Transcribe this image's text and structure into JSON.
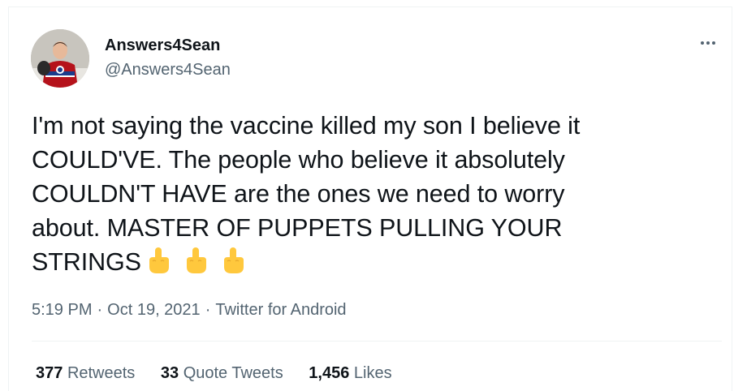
{
  "author": {
    "display_name": "Answers4Sean",
    "handle": "@Answers4Sean"
  },
  "tweet": {
    "lines": [
      "I'm not saying the vaccine killed my son I believe it",
      "COULD'VE. The people who believe it absolutely",
      "COULDN'T HAVE are the ones we need to worry",
      "about. MASTER OF PUPPETS PULLING YOUR",
      "STRINGS"
    ],
    "emojis": [
      "middle-finger",
      "middle-finger",
      "middle-finger"
    ]
  },
  "meta": {
    "time": "5:19 PM",
    "separator": "·",
    "date": "Oct 19, 2021",
    "source": "Twitter for Android"
  },
  "stats": {
    "retweets_count": "377",
    "retweets_label": "Retweets",
    "quotes_count": "33",
    "quotes_label": "Quote Tweets",
    "likes_count": "1,456",
    "likes_label": "Likes"
  },
  "colors": {
    "text": "#0f1419",
    "secondary": "#536471",
    "divider": "#eff3f4",
    "emoji": "#ffc83d"
  }
}
